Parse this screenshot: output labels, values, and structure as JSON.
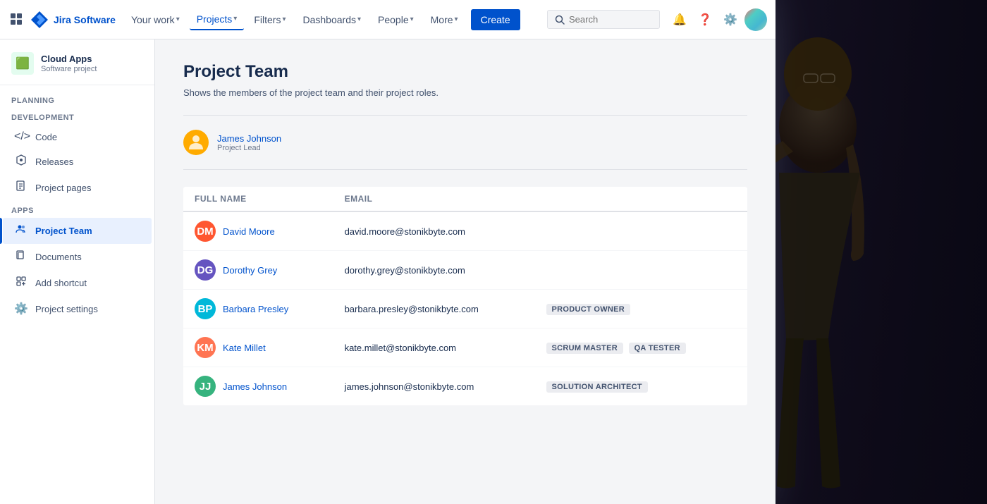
{
  "app": {
    "name": "Jira Software"
  },
  "nav": {
    "your_work": "Your work",
    "projects": "Projects",
    "filters": "Filters",
    "dashboards": "Dashboards",
    "people": "People",
    "more": "More",
    "create": "Create",
    "search_placeholder": "Search"
  },
  "sidebar": {
    "project_name": "Cloud Apps",
    "project_type": "Software project",
    "planning_label": "PLANNING",
    "development_label": "DEVELOPMENT",
    "apps_label": "APPS",
    "items": [
      {
        "id": "code",
        "label": "Code",
        "icon": "</>"
      },
      {
        "id": "releases",
        "label": "Releases",
        "icon": "📦"
      },
      {
        "id": "project-pages",
        "label": "Project pages",
        "icon": "📄"
      },
      {
        "id": "project-team",
        "label": "Project Team",
        "icon": "👥",
        "active": true
      },
      {
        "id": "documents",
        "label": "Documents",
        "icon": "📁"
      },
      {
        "id": "add-shortcut",
        "label": "Add shortcut",
        "icon": "+"
      },
      {
        "id": "project-settings",
        "label": "Project settings",
        "icon": "⚙️"
      }
    ]
  },
  "page": {
    "title": "Project Team",
    "description": "Shows the members of the project team and their project roles."
  },
  "project_lead": {
    "name": "James Johnson",
    "role": "Project Lead"
  },
  "table": {
    "columns": [
      "Full name",
      "Email",
      ""
    ],
    "members": [
      {
        "name": "David Moore",
        "email": "david.moore@stonikbyte.com",
        "role": "",
        "avatar_class": "av-david",
        "initials": "DM"
      },
      {
        "name": "Dorothy Grey",
        "email": "dorothy.grey@stonikbyte.com",
        "role": "",
        "avatar_class": "av-dorothy",
        "initials": "DG"
      },
      {
        "name": "Barbara Presley",
        "email": "barbara.presley@stonikbyte.com",
        "role": "PRODUCT OWNER",
        "avatar_class": "av-barbara",
        "initials": "BP"
      },
      {
        "name": "Kate Millet",
        "email": "kate.millet@stonikbyte.com",
        "role": "SCRUM MASTER",
        "role2": "QA TESTER",
        "avatar_class": "av-kate",
        "initials": "KM"
      },
      {
        "name": "James Johnson",
        "email": "james.johnson@stonikbyte.com",
        "role": "SOLUTION ARCHITECT",
        "avatar_class": "av-james2",
        "initials": "JJ"
      }
    ]
  }
}
